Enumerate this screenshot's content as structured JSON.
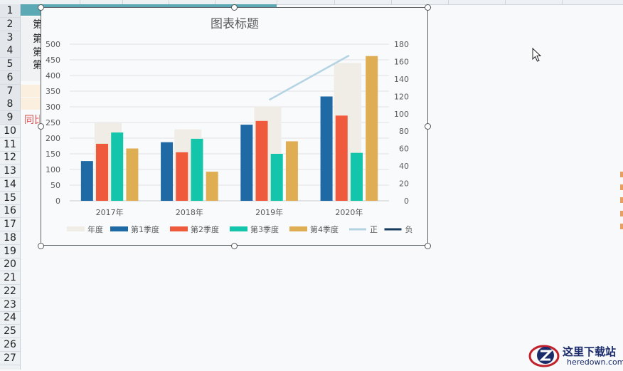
{
  "sheet": {
    "row_numbers": [
      "1",
      "2",
      "3",
      "4",
      "5",
      "6",
      "7",
      "8",
      "9",
      "10",
      "11",
      "12",
      "13",
      "14",
      "15",
      "16",
      "17",
      "18",
      "19",
      "20",
      "21",
      "22",
      "23",
      "24",
      "25",
      "26",
      "27"
    ],
    "cell_fragments": [
      "第",
      "第",
      "第",
      "第"
    ],
    "red_fragment": "同比"
  },
  "watermark": {
    "title": "这里下载站",
    "url": "heredown.com"
  },
  "chart_data": {
    "type": "bar",
    "title": "图表标题",
    "categories": [
      "2017年",
      "2018年",
      "2019年",
      "2020年"
    ],
    "left_axis": {
      "min": 0,
      "max": 500,
      "ticks": [
        "0",
        "50",
        "100",
        "150",
        "200",
        "250",
        "300",
        "350",
        "400",
        "450",
        "500"
      ]
    },
    "right_axis": {
      "min": 0,
      "max": 180,
      "ticks": [
        "0",
        "20",
        "40",
        "60",
        "80",
        "100",
        "120",
        "140",
        "160",
        "180"
      ]
    },
    "grid": true,
    "legend_position": "bottom",
    "series": [
      {
        "name": "年度",
        "type": "bar-background",
        "axis": "left",
        "color": "#efede5",
        "values": [
          248,
          228,
          302,
          440
        ]
      },
      {
        "name": "第1季度",
        "type": "bar",
        "axis": "left",
        "color": "#1f6aa5",
        "values": [
          127,
          187,
          243,
          333
        ]
      },
      {
        "name": "第2季度",
        "type": "bar",
        "axis": "left",
        "color": "#f05a3c",
        "values": [
          182,
          155,
          255,
          272
        ]
      },
      {
        "name": "第3季度",
        "type": "bar",
        "axis": "left",
        "color": "#12c5ab",
        "values": [
          218,
          198,
          150,
          153
        ]
      },
      {
        "name": "第4季度",
        "type": "bar",
        "axis": "left",
        "color": "#e0ae52",
        "values": [
          167,
          93,
          190,
          462
        ]
      },
      {
        "name": "正",
        "type": "line",
        "axis": "right",
        "color": "#b4d3e3",
        "values": [
          null,
          null,
          116,
          167
        ]
      },
      {
        "name": "负",
        "type": "line",
        "axis": "right",
        "color": "#163a5c",
        "values": [
          null,
          null,
          null,
          null
        ]
      }
    ]
  }
}
